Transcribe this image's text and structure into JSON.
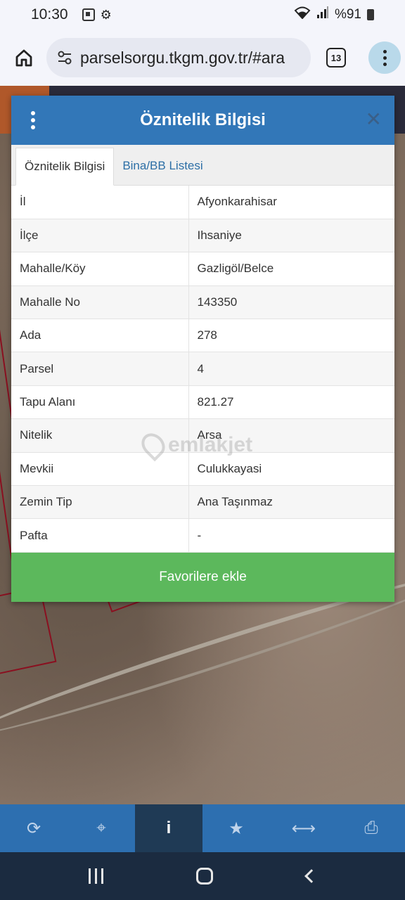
{
  "status": {
    "time": "10:30",
    "battery": "%91"
  },
  "browser": {
    "url": "parselsorgu.tkgm.gov.tr/#ara",
    "tab_count": "13"
  },
  "modal": {
    "title": "Öznitelik Bilgisi",
    "tabs": [
      {
        "label": "Öznitelik Bilgisi",
        "active": true
      },
      {
        "label": "Bina/BB Listesi",
        "active": false
      }
    ],
    "rows": [
      {
        "key": "İl",
        "value": "Afyonkarahisar"
      },
      {
        "key": "İlçe",
        "value": "Ihsaniye"
      },
      {
        "key": "Mahalle/Köy",
        "value": "Gazligöl/Belce"
      },
      {
        "key": "Mahalle No",
        "value": "143350"
      },
      {
        "key": "Ada",
        "value": "278"
      },
      {
        "key": "Parsel",
        "value": "4"
      },
      {
        "key": "Tapu Alanı",
        "value": "821.27"
      },
      {
        "key": "Nitelik",
        "value": "Arsa"
      },
      {
        "key": "Mevkii",
        "value": "Culukkayasi"
      },
      {
        "key": "Zemin Tip",
        "value": "Ana Taşınmaz"
      },
      {
        "key": "Pafta",
        "value": "-"
      }
    ],
    "favorite_label": "Favorilere ekle"
  },
  "watermark": "emlakjet",
  "toolbar": [
    "refresh-icon",
    "locate-icon",
    "info-icon",
    "star-icon",
    "measure-icon",
    "print-icon"
  ]
}
